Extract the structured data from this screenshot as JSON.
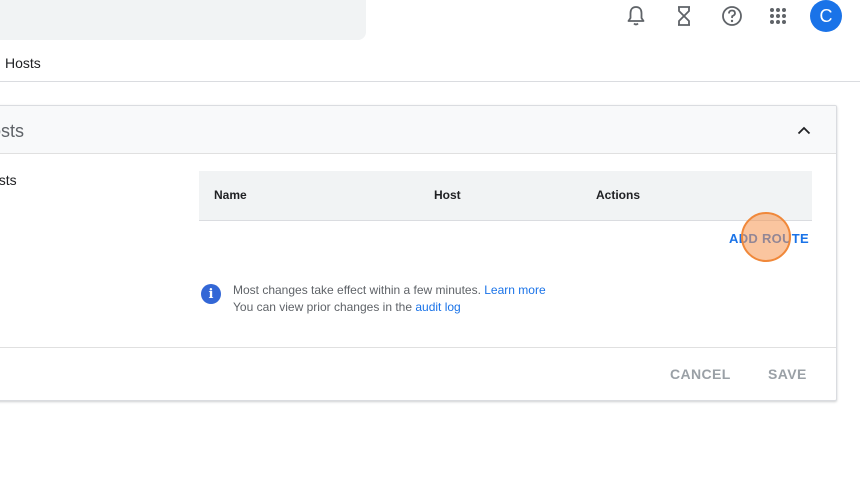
{
  "topbar": {
    "icons": [
      "notifications-bell-icon",
      "hourglass-icon",
      "help-icon",
      "apps-grid-icon"
    ],
    "avatar_letter": "C"
  },
  "breadcrumb": {
    "current": "Hosts"
  },
  "card": {
    "title": "osts",
    "section_label": "osts",
    "table": {
      "columns": [
        "Name",
        "Host",
        "Actions"
      ],
      "rows": []
    },
    "add_route_label": "ADD ROUTE",
    "info": {
      "line1": "Most changes take effect within a few minutes.",
      "line1_link": "Learn more",
      "line2": "You can view prior changes in the",
      "line2_link": "audit log"
    },
    "footer": {
      "cancel_label": "CANCEL",
      "save_label": "SAVE"
    }
  },
  "colors": {
    "accent": "#1a73e8",
    "avatar": "#1a73e8",
    "info_icon": "#3367d6",
    "click_marker": "#f0883a"
  }
}
